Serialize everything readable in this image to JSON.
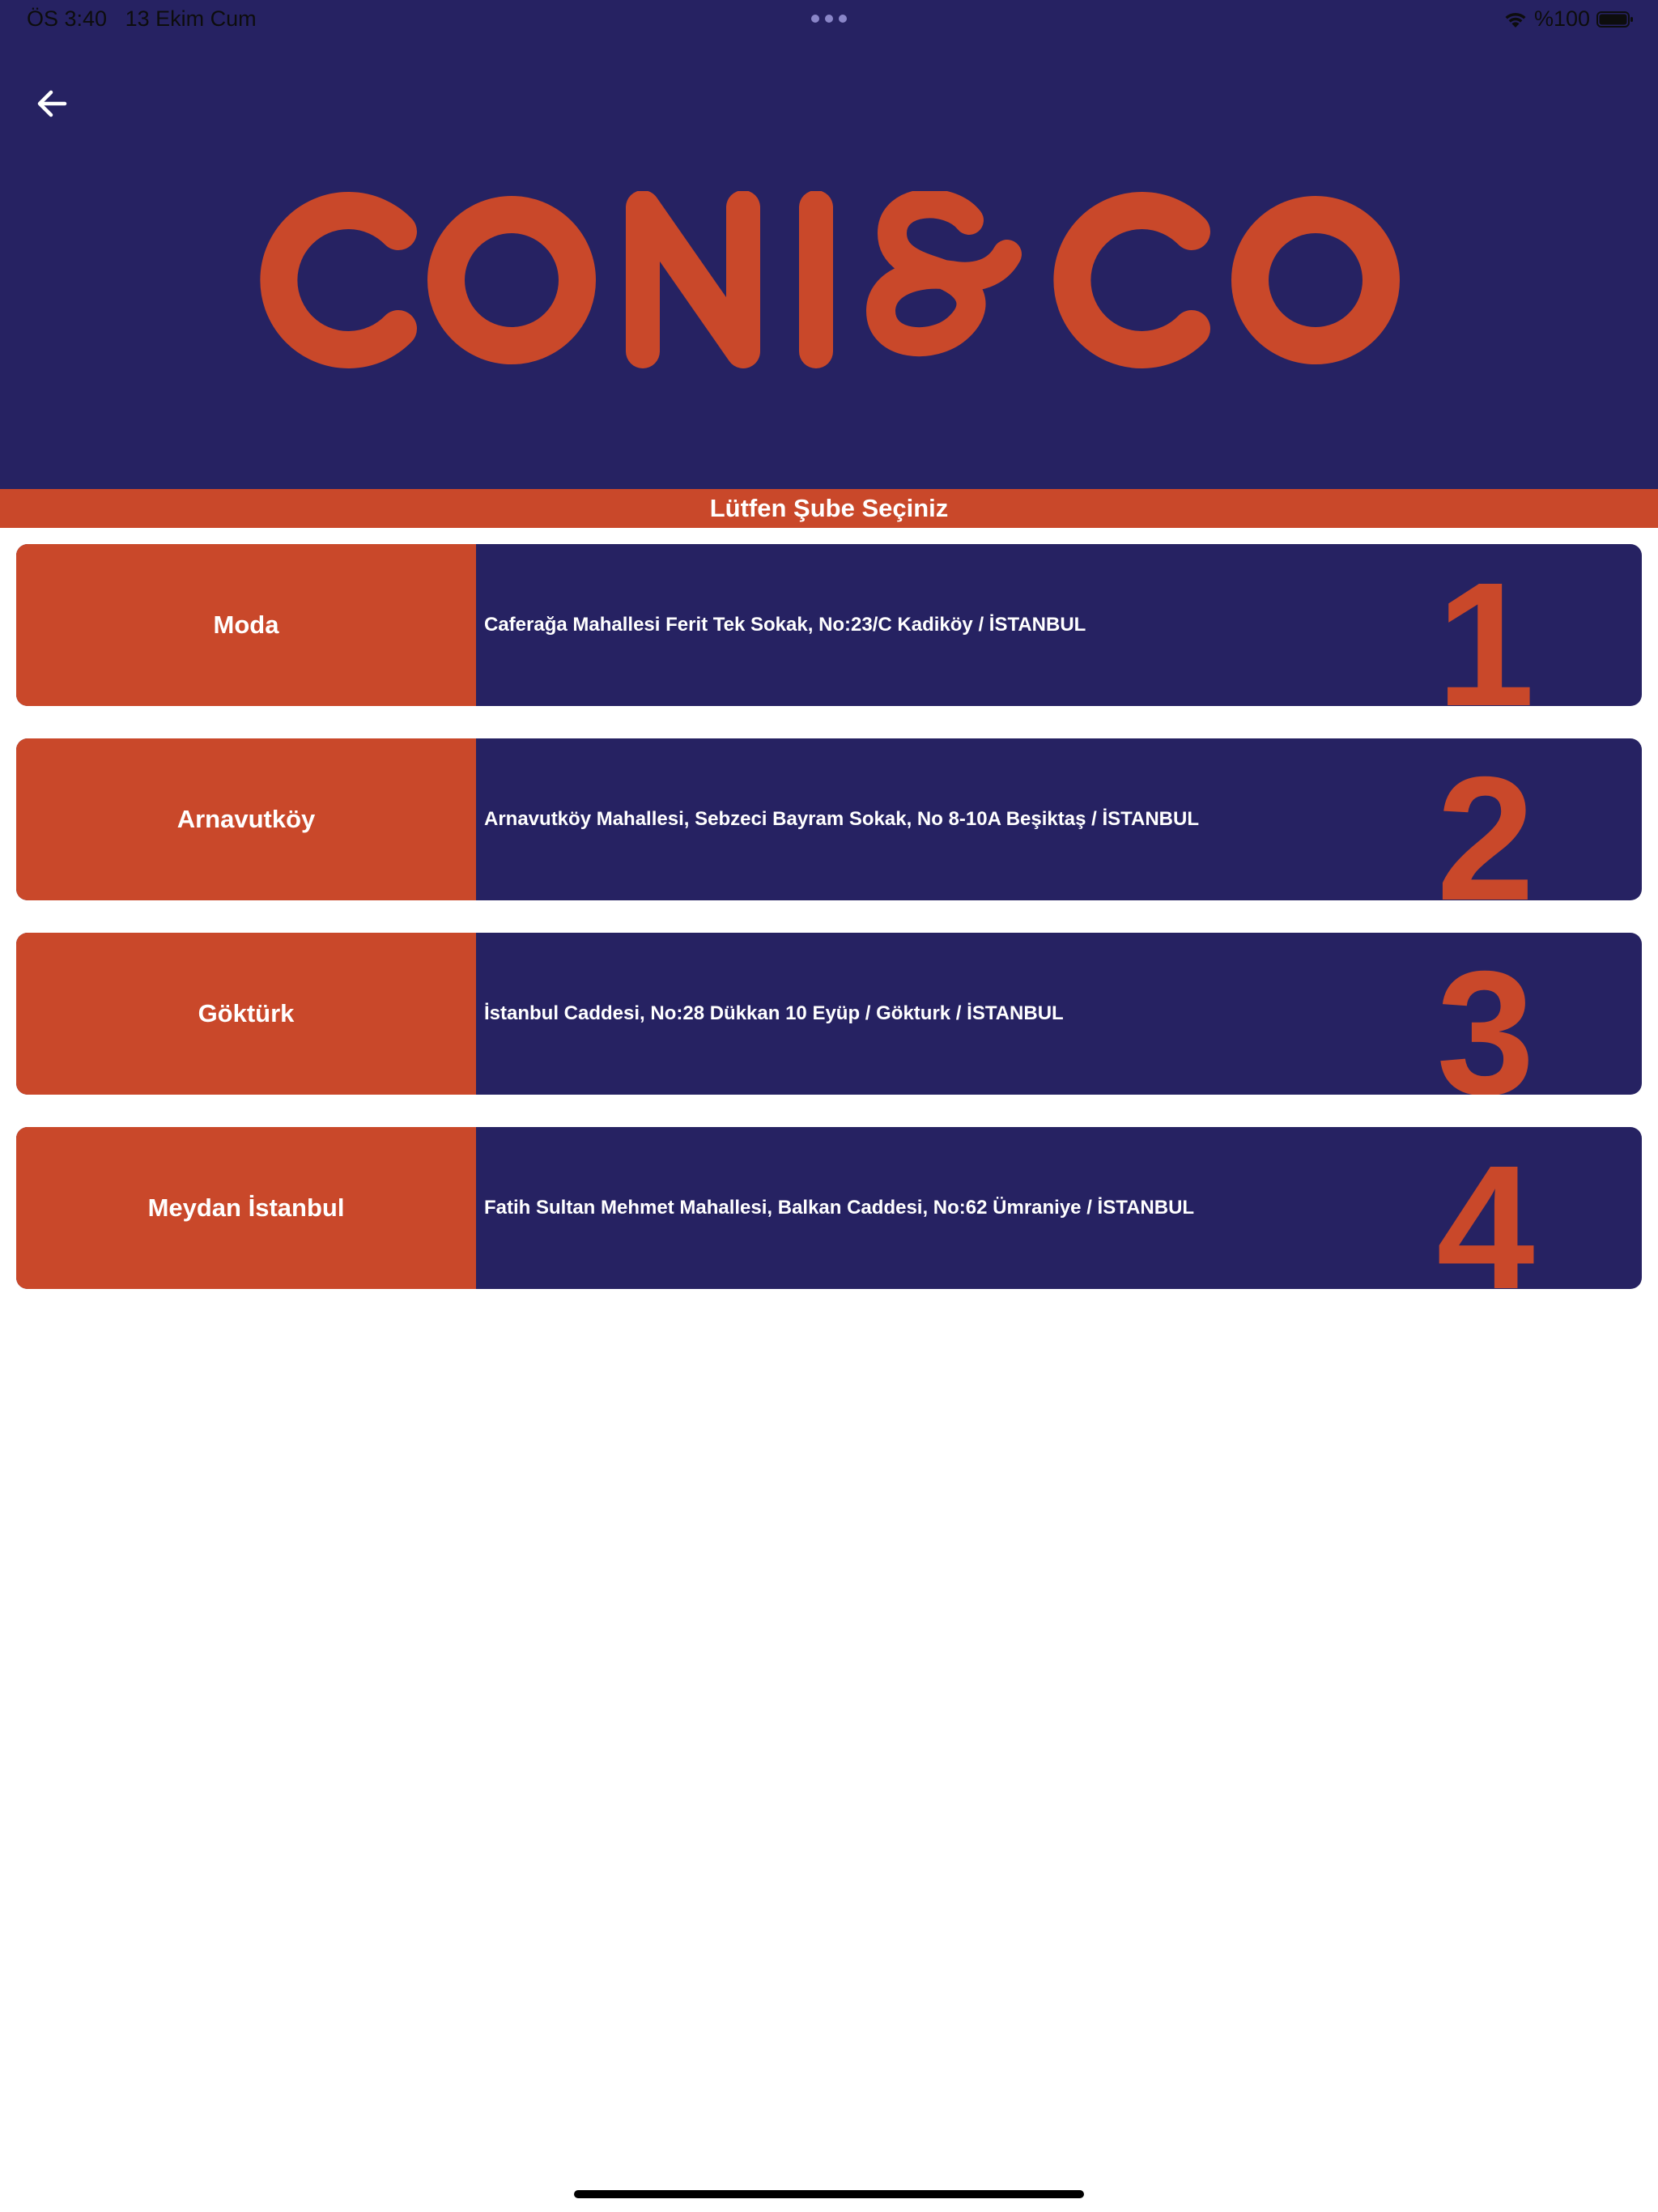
{
  "status_bar": {
    "time": "ÖS 3:40",
    "date": "13 Ekim Cum",
    "battery_text": "%100",
    "icons": [
      "more-dots-icon",
      "wifi-icon",
      "battery-icon"
    ]
  },
  "header": {
    "back_icon": "arrow-left-icon",
    "logo_text": "CONI&CO",
    "background_color": "#262262",
    "accent_color": "#c9482a"
  },
  "page_title": "Lütfen Şube Seçiniz",
  "branches": [
    {
      "name": "Moda",
      "address": "Caferağa Mahallesi Ferit Tek Sokak, No:23/C Kadiköy / İSTANBUL",
      "number": "1"
    },
    {
      "name": "Arnavutköy",
      "address": "Arnavutköy Mahallesi, Sebzeci Bayram Sokak, No 8-10A Beşiktaş / İSTANBUL",
      "number": "2"
    },
    {
      "name": "Göktürk",
      "address": "İstanbul Caddesi, No:28 Dükkan 10 Eyüp / Gökturk / İSTANBUL",
      "number": "3"
    },
    {
      "name": "Meydan İstanbul",
      "address": "Fatih Sultan Mehmet Mahallesi, Balkan Caddesi,  No:62 Ümraniye / İSTANBUL",
      "number": "4"
    }
  ]
}
